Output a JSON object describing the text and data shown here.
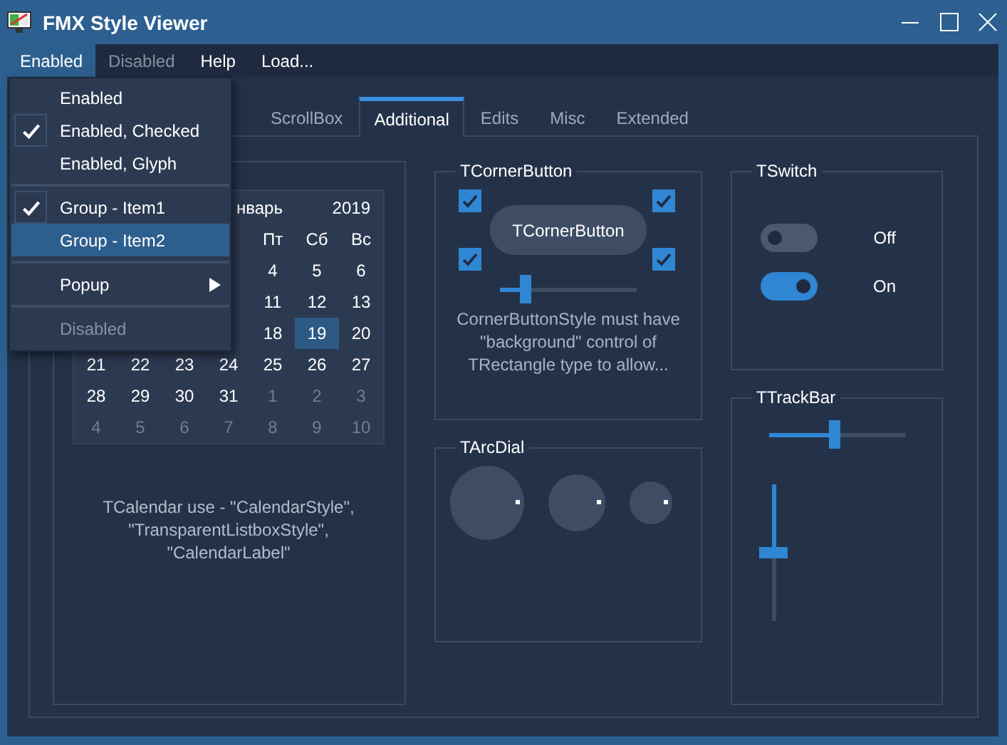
{
  "window": {
    "title": "FMX Style Viewer"
  },
  "menubar": [
    {
      "label": "Enabled",
      "selected": true,
      "disabled": false
    },
    {
      "label": "Disabled",
      "selected": false,
      "disabled": true
    },
    {
      "label": "Help",
      "selected": false,
      "disabled": false
    },
    {
      "label": "Load...",
      "selected": false,
      "disabled": false
    }
  ],
  "menu": [
    {
      "kind": "item",
      "label": "Enabled",
      "checked": false,
      "selected": false,
      "disabled": false,
      "submenu": false
    },
    {
      "kind": "item",
      "label": "Enabled, Checked",
      "checked": true,
      "selected": false,
      "disabled": false,
      "submenu": false
    },
    {
      "kind": "item",
      "label": "Enabled, Glyph",
      "checked": false,
      "selected": false,
      "disabled": false,
      "submenu": false
    },
    {
      "kind": "separator"
    },
    {
      "kind": "item",
      "label": "Group - Item1",
      "checked": true,
      "selected": false,
      "disabled": false,
      "submenu": false
    },
    {
      "kind": "item",
      "label": "Group - Item2",
      "checked": false,
      "selected": true,
      "disabled": false,
      "submenu": false
    },
    {
      "kind": "separator"
    },
    {
      "kind": "item",
      "label": "Popup",
      "checked": false,
      "selected": false,
      "disabled": false,
      "submenu": true
    },
    {
      "kind": "separator"
    },
    {
      "kind": "item",
      "label": "Disabled",
      "checked": false,
      "selected": false,
      "disabled": true,
      "submenu": false
    }
  ],
  "tabs": [
    {
      "label": "ScrollBox",
      "selected": false
    },
    {
      "label": "Additional",
      "selected": true
    },
    {
      "label": "Edits",
      "selected": false
    },
    {
      "label": "Misc",
      "selected": false
    },
    {
      "label": "Extended",
      "selected": false
    }
  ],
  "calendar": {
    "month": "нварь",
    "year": "2019",
    "weekdays": [
      "Пт",
      "Сб",
      "Вс"
    ],
    "weeks": [
      [
        {
          "day": "4",
          "muted": false,
          "selected": false
        },
        {
          "day": "5",
          "muted": false,
          "selected": false
        },
        {
          "day": "6",
          "muted": false,
          "selected": false
        }
      ],
      [
        {
          "day": "11",
          "muted": false,
          "selected": false
        },
        {
          "day": "12",
          "muted": false,
          "selected": false
        },
        {
          "day": "13",
          "muted": false,
          "selected": false
        }
      ],
      [
        {
          "day": "18",
          "muted": false,
          "selected": false
        },
        {
          "day": "19",
          "muted": false,
          "selected": true
        },
        {
          "day": "20",
          "muted": false,
          "selected": false
        }
      ],
      [
        {
          "day": "21",
          "muted": false,
          "selected": false
        },
        {
          "day": "22",
          "muted": false,
          "selected": false
        },
        {
          "day": "23",
          "muted": false,
          "selected": false
        },
        {
          "day": "24",
          "muted": false,
          "selected": false
        },
        {
          "day": "25",
          "muted": false,
          "selected": false
        },
        {
          "day": "26",
          "muted": false,
          "selected": false
        },
        {
          "day": "27",
          "muted": false,
          "selected": false
        }
      ],
      [
        {
          "day": "28",
          "muted": false,
          "selected": false
        },
        {
          "day": "29",
          "muted": false,
          "selected": false
        },
        {
          "day": "30",
          "muted": false,
          "selected": false
        },
        {
          "day": "31",
          "muted": false,
          "selected": false
        },
        {
          "day": "1",
          "muted": true,
          "selected": false
        },
        {
          "day": "2",
          "muted": true,
          "selected": false
        },
        {
          "day": "3",
          "muted": true,
          "selected": false
        }
      ],
      [
        {
          "day": "4",
          "muted": true,
          "selected": false
        },
        {
          "day": "5",
          "muted": true,
          "selected": false
        },
        {
          "day": "6",
          "muted": true,
          "selected": false
        },
        {
          "day": "7",
          "muted": true,
          "selected": false
        },
        {
          "day": "8",
          "muted": true,
          "selected": false
        },
        {
          "day": "9",
          "muted": true,
          "selected": false
        },
        {
          "day": "10",
          "muted": true,
          "selected": false
        }
      ]
    ],
    "caption": "TCalendar use - \"CalendarStyle\",\n\"TransparentListboxStyle\", \"CalendarLabel\""
  },
  "corner_button": {
    "title": "TCornerButton",
    "button": "TCornerButton",
    "checkboxes": [
      {
        "checked": true
      },
      {
        "checked": true
      },
      {
        "checked": true
      },
      {
        "checked": true
      }
    ],
    "slider": {
      "level": 0.19
    },
    "note": "CornerButtonStyle must have \"background\" control of TRectangle type to allow..."
  },
  "arc_dial": {
    "title": "TArcDial"
  },
  "switches": {
    "title": "TSwitch",
    "items": [
      {
        "label": "Off",
        "on": false
      },
      {
        "label": "On",
        "on": true
      }
    ]
  },
  "trackbar": {
    "title": "TTrackBar",
    "horizontal": {
      "level": 0.48
    },
    "vertical": {
      "level": 0.5
    }
  }
}
